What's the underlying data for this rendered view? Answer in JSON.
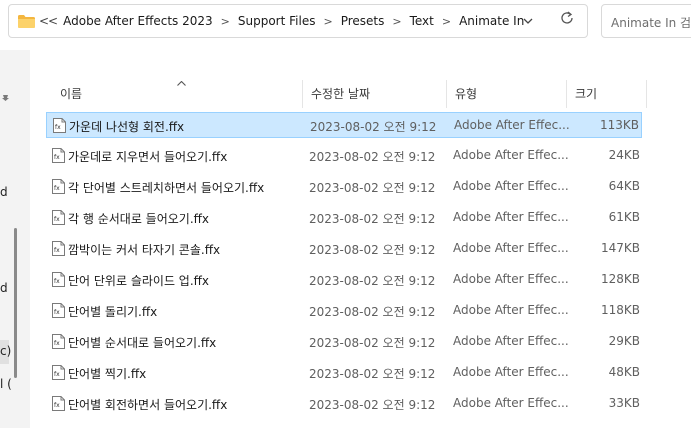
{
  "address": {
    "overflow": "<<",
    "path": [
      "Adobe After Effects 2023",
      "Support Files",
      "Presets",
      "Text",
      "Animate In"
    ],
    "separator": ">"
  },
  "search": {
    "placeholder": "Animate In 검색"
  },
  "nav": {
    "fragments": [
      "d",
      "d",
      "c)",
      "l ("
    ]
  },
  "columns": {
    "name": "이름",
    "date": "수정한 날짜",
    "type": "유형",
    "size": "크기"
  },
  "files": [
    {
      "name": "가운데 나선형 회전.ffx",
      "date": "2023-08-02 오전 9:12",
      "type": "Adobe After Effec...",
      "size": "113KB",
      "selected": true
    },
    {
      "name": "가운데로 지우면서 들어오기.ffx",
      "date": "2023-08-02 오전 9:12",
      "type": "Adobe After Effec...",
      "size": "24KB",
      "selected": false
    },
    {
      "name": "각 단어별 스트레치하면서 들어오기.ffx",
      "date": "2023-08-02 오전 9:12",
      "type": "Adobe After Effec...",
      "size": "64KB",
      "selected": false
    },
    {
      "name": "각 행 순서대로 들어오기.ffx",
      "date": "2023-08-02 오전 9:12",
      "type": "Adobe After Effec...",
      "size": "61KB",
      "selected": false
    },
    {
      "name": "깜박이는 커서 타자기 콘솔.ffx",
      "date": "2023-08-02 오전 9:12",
      "type": "Adobe After Effec...",
      "size": "147KB",
      "selected": false
    },
    {
      "name": "단어 단위로 슬라이드 업.ffx",
      "date": "2023-08-02 오전 9:12",
      "type": "Adobe After Effec...",
      "size": "128KB",
      "selected": false
    },
    {
      "name": "단어별 돌리기.ffx",
      "date": "2023-08-02 오전 9:12",
      "type": "Adobe After Effec...",
      "size": "118KB",
      "selected": false
    },
    {
      "name": "단어별 순서대로 들어오기.ffx",
      "date": "2023-08-02 오전 9:12",
      "type": "Adobe After Effec...",
      "size": "29KB",
      "selected": false
    },
    {
      "name": "단어별 찍기.ffx",
      "date": "2023-08-02 오전 9:12",
      "type": "Adobe After Effec...",
      "size": "48KB",
      "selected": false
    },
    {
      "name": "단어별 회전하면서 들어오기.ffx",
      "date": "2023-08-02 오전 9:12",
      "type": "Adobe After Effec...",
      "size": "33KB",
      "selected": false
    }
  ],
  "colors": {
    "selection": "#cce8ff",
    "selection_border": "#99d1ff",
    "folder": "#f8c55b"
  },
  "icons": {
    "folder": "folder-icon",
    "file": "ffx-file-icon",
    "refresh": "refresh-icon",
    "dropdown": "chevron-down-icon",
    "pin": "pin-icon",
    "sort": "sort-up-icon"
  }
}
